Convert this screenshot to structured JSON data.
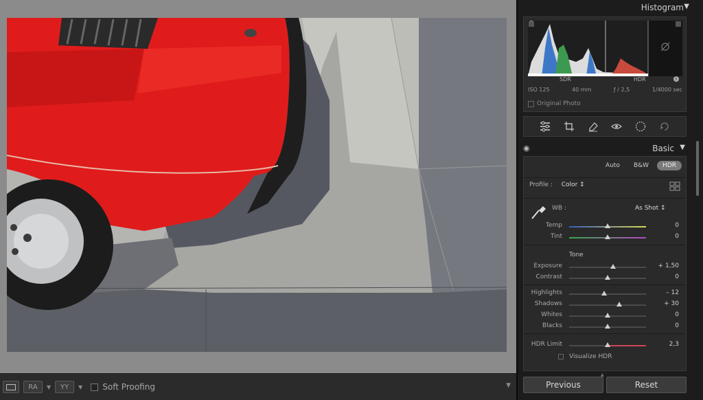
{
  "toolbar": {
    "soft_proofing_label": "Soft Proofing",
    "compare_label": "RA",
    "survey_label": "YY"
  },
  "histogram": {
    "title": "Histogram",
    "sdr_label": "SDR",
    "hdr_label": "HDR",
    "iso": "ISO 125",
    "focal": "40 mm",
    "aperture": "ƒ / 2,5",
    "shutter": "1/4000 sec",
    "original_photo_label": "Original Photo"
  },
  "basic": {
    "title": "Basic",
    "modes": [
      "Auto",
      "B&W",
      "HDR"
    ],
    "active_mode": "HDR",
    "profile_label": "Profile :",
    "profile_value": "Color ↕",
    "wb_label": "WB :",
    "wb_value": "As Shot ↕",
    "tone_label": "Tone",
    "visualize_hdr_label": "Visualize HDR",
    "sliders": [
      {
        "key": "temp",
        "label": "Temp",
        "value": "0",
        "pos": 0.5
      },
      {
        "key": "tint",
        "label": "Tint",
        "value": "0",
        "pos": 0.5
      },
      {
        "key": "exposure",
        "label": "Exposure",
        "value": "+ 1,50",
        "pos": 0.575
      },
      {
        "key": "contrast",
        "label": "Contrast",
        "value": "0",
        "pos": 0.5
      },
      {
        "key": "highlights",
        "label": "Highlights",
        "value": "– 12",
        "pos": 0.45
      },
      {
        "key": "shadows",
        "label": "Shadows",
        "value": "+ 30",
        "pos": 0.65
      },
      {
        "key": "whites",
        "label": "Whites",
        "value": "0",
        "pos": 0.5
      },
      {
        "key": "blacks",
        "label": "Blacks",
        "value": "0",
        "pos": 0.5
      },
      {
        "key": "hdr_limit",
        "label": "HDR Limit",
        "value": "2,3",
        "pos": 0.5
      }
    ]
  },
  "buttons": {
    "previous": "Previous",
    "reset": "Reset"
  },
  "colors": {
    "car_red": "#e01b1b",
    "panel_bg": "#1c1c1c",
    "section_bg": "#2a2a2a"
  }
}
